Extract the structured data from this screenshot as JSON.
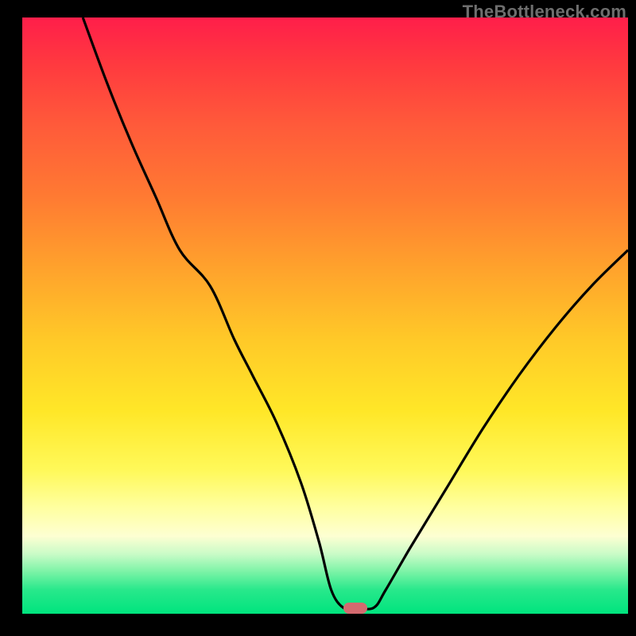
{
  "watermark": "TheBottleneck.com",
  "colors": {
    "curve": "#000000",
    "marker": "#d36a6f"
  },
  "chart_data": {
    "type": "line",
    "title": "",
    "xlabel": "",
    "ylabel": "",
    "xlim": [
      0,
      100
    ],
    "ylim": [
      0,
      100
    ],
    "grid": false,
    "legend": false,
    "annotations": [
      {
        "kind": "marker",
        "x": 55,
        "y": 1,
        "shape": "pill"
      }
    ],
    "series": [
      {
        "name": "curve",
        "x": [
          10,
          14,
          18,
          22,
          26,
          31,
          35,
          38,
          42,
          46,
          49,
          51,
          53,
          55,
          58,
          60,
          64,
          70,
          76,
          82,
          88,
          94,
          100
        ],
        "values": [
          100,
          89,
          79,
          70,
          61,
          55,
          46,
          40,
          32,
          22,
          12,
          4,
          1,
          1,
          1,
          4,
          11,
          21,
          31,
          40,
          48,
          55,
          61
        ]
      }
    ],
    "background_gradient": {
      "direction": "vertical",
      "stops": [
        {
          "pos": 0.0,
          "color": "#ff1e4a"
        },
        {
          "pos": 0.3,
          "color": "#ff7a32"
        },
        {
          "pos": 0.66,
          "color": "#ffe728"
        },
        {
          "pos": 0.87,
          "color": "#fdffd2"
        },
        {
          "pos": 1.0,
          "color": "#00e47e"
        }
      ]
    }
  }
}
